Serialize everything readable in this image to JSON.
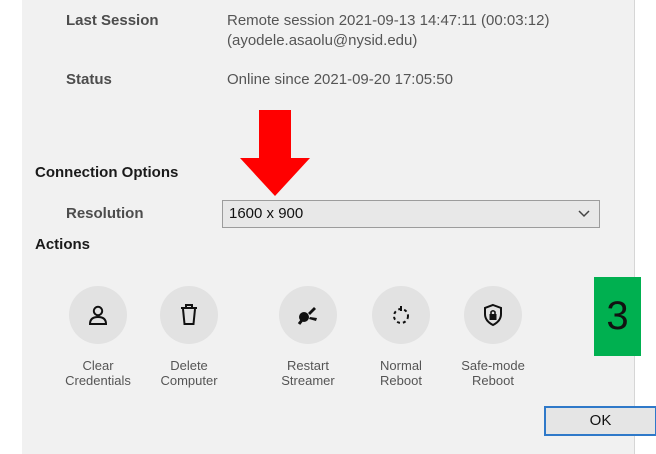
{
  "session": {
    "last_session_label": "Last Session",
    "last_session_line1": "Remote session 2021-09-13 14:47:11 (00:03:12)",
    "last_session_line2": "(ayodele.asaolu@nysid.edu)",
    "status_label": "Status",
    "status_value": "Online since 2021-09-20 17:05:50"
  },
  "connection": {
    "title": "Connection Options",
    "resolution_label": "Resolution",
    "resolution_value": "1600 x 900"
  },
  "actions": {
    "title": "Actions",
    "items": [
      {
        "line1": "Clear",
        "line2": "Credentials",
        "icon": "user-icon"
      },
      {
        "line1": "Delete",
        "line2": "Computer",
        "icon": "trash-icon"
      },
      {
        "line1": "Restart",
        "line2": "Streamer",
        "icon": "restart-streamer-icon"
      },
      {
        "line1": "Normal",
        "line2": "Reboot",
        "icon": "reboot-icon"
      },
      {
        "line1": "Safe-mode",
        "line2": "Reboot",
        "icon": "shield-lock-icon"
      }
    ]
  },
  "ok_label": "OK",
  "annotation": {
    "step_number": "3",
    "step_color": "#00b050",
    "arrow_color": "#ff0000"
  },
  "colors": {
    "dialog_bg": "#f1f1f1",
    "focus_border": "#2f79c9"
  }
}
